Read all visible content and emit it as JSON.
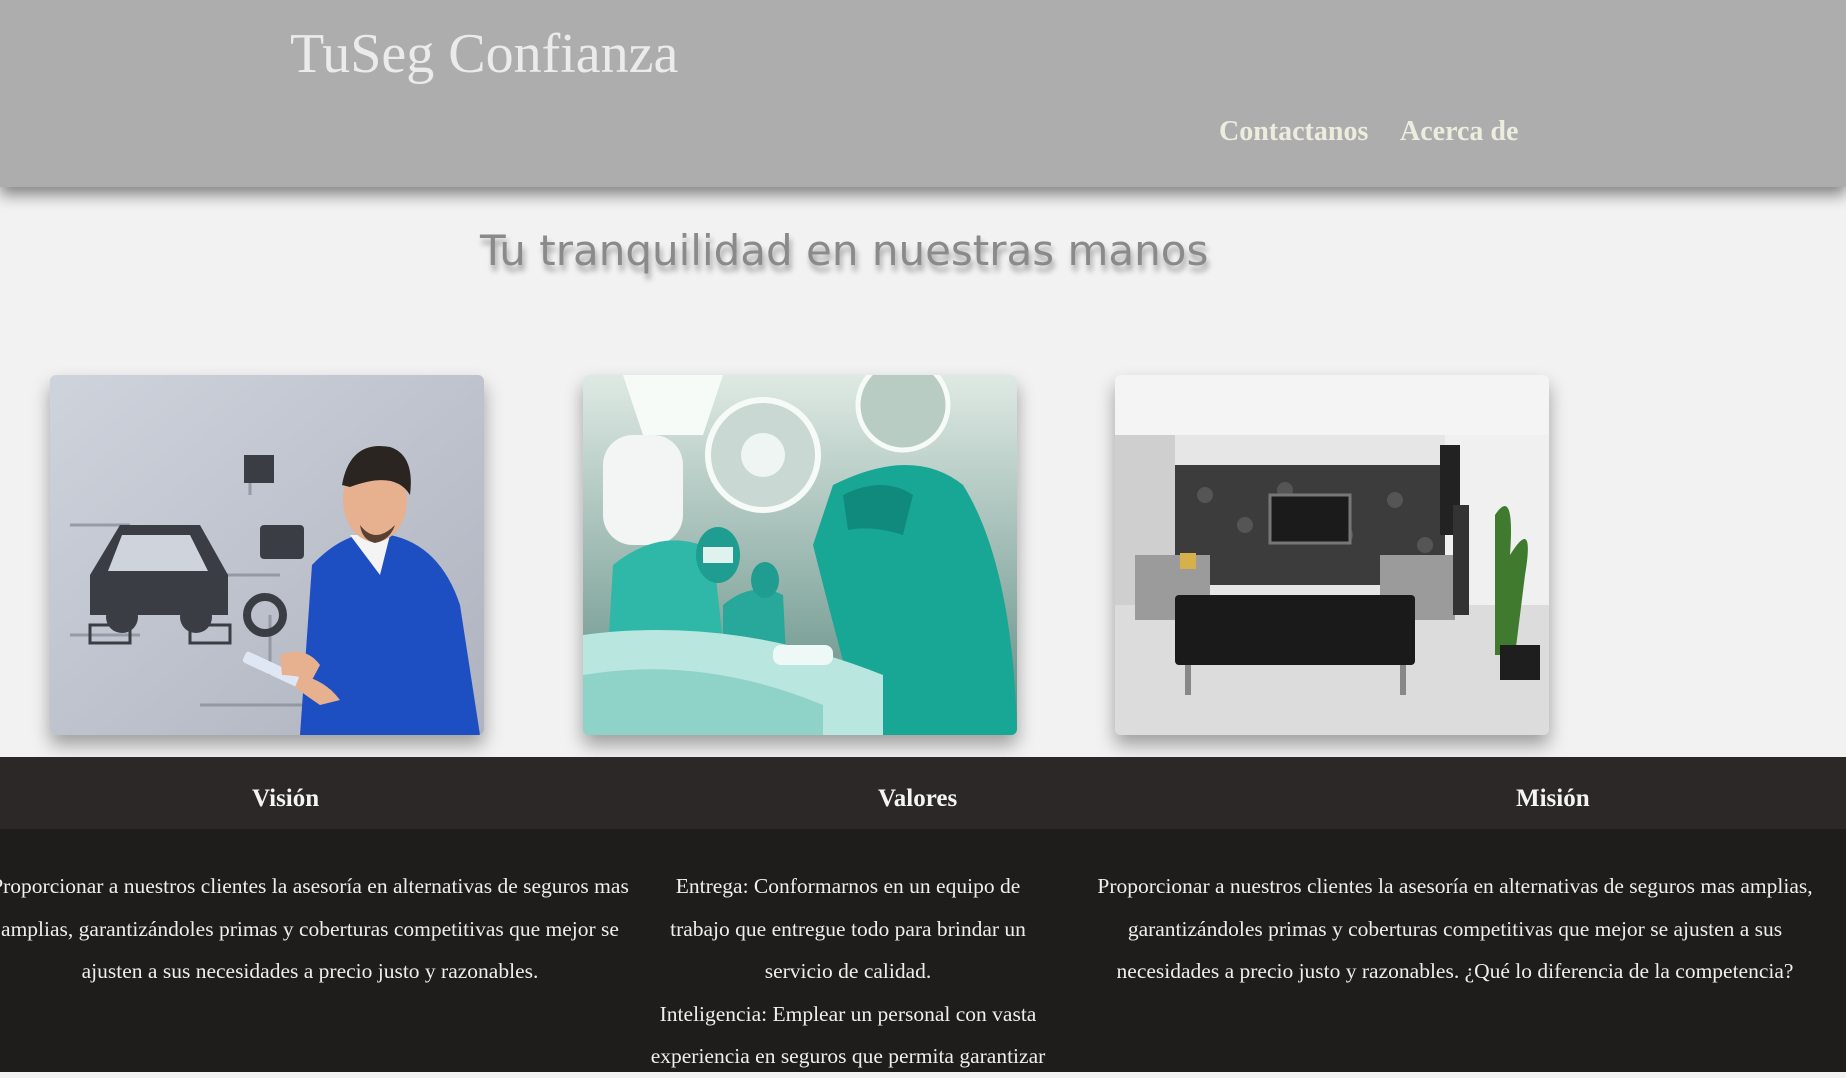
{
  "header": {
    "brand": "TuSeg Confianza",
    "nav": {
      "contact": "Contactanos",
      "about": "Acerca de"
    }
  },
  "hero": {
    "tagline": "Tu tranquilidad en nuestras manos"
  },
  "cards": [
    {
      "subject": "mechanic with tablet and car diagram"
    },
    {
      "subject": "surgeons in operating room"
    },
    {
      "subject": "modern living room interior"
    }
  ],
  "sections": {
    "vision": {
      "title": "Visión",
      "text": "Proporcionar a nuestros clientes la asesoría en alternativas de seguros mas amplias, garantizándoles primas y coberturas competitivas que mejor se ajusten a sus necesidades a precio justo y razonables."
    },
    "valores": {
      "title": "Valores",
      "text_1": "Entrega: Conformarnos en un equipo de trabajo que entregue todo para brindar un servicio de calidad.",
      "text_2": "Inteligencia: Emplear un personal con vasta experiencia en seguros que permita garantizar"
    },
    "mision": {
      "title": "Misión",
      "text": "Proporcionar a nuestros clientes la asesoría en alternativas de seguros mas amplias, garantizándoles primas y coberturas competitivas que mejor se ajusten a sus necesidades a precio justo y razonables. ¿Qué lo diferencia de la competencia?"
    }
  },
  "colors": {
    "header_bg": "#adadad",
    "page_bg": "#f2f2f2",
    "band_bg": "#1f1c1c",
    "band_head_bg": "#2c2828"
  }
}
